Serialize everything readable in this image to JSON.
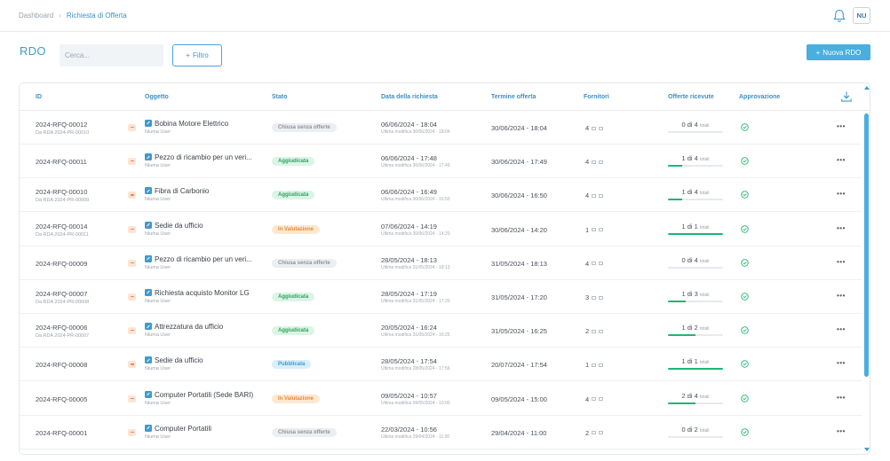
{
  "breadcrumb": {
    "home": "Dashboard",
    "separator": "›",
    "current": "Richiesta di Offerta"
  },
  "user": {
    "initials": "NU"
  },
  "page": {
    "title": "RDO"
  },
  "search": {
    "placeholder": "Cerca..."
  },
  "toolbar": {
    "filter_label": "Filtro",
    "new_label": "Nuova RDO",
    "plus": "+"
  },
  "colors": {
    "accent": "#4aaedf",
    "green": "#22b573",
    "orange": "#e8893a"
  },
  "table": {
    "headers": {
      "id": "ID",
      "oggetto": "Oggetto",
      "stato": "Stato",
      "data": "Data della richiesta",
      "termine": "Termine offerta",
      "fornitori": "Fornitori",
      "offerte": "Offerte ricevute",
      "approvazione": "Approvazione"
    },
    "rows": [
      {
        "id": "2024-RFQ-00012",
        "sub": "Da RDA 2024-PR-00010",
        "title": "Bobina Motore Elettrico",
        "user": "Niuma User",
        "status": "Chiusa senza offerte",
        "status_type": "grey",
        "date": "06/06/2024 - 18:04",
        "modified": "Ultima modifica 30/06/2024 - 18:04",
        "deadline": "30/06/2024 - 18:04",
        "suppliers": "4",
        "offers": "0 di 4",
        "offers_ratio": 0,
        "total": "totali"
      },
      {
        "id": "2024-RFQ-00011",
        "sub": "",
        "title": "Pezzo di ricambio per un veri...",
        "user": "Niuma User",
        "status": "Aggiudicata",
        "status_type": "green",
        "date": "06/06/2024 - 17:48",
        "modified": "Ultima modifica 30/06/2024 - 17:49",
        "deadline": "30/06/2024 - 17:49",
        "suppliers": "4",
        "offers": "1 di 4",
        "offers_ratio": 0.25,
        "total": "totali"
      },
      {
        "id": "2024-RFQ-00010",
        "sub": "Da RDA 2024-PR-00009",
        "title": "Fibra di Carbonio",
        "user": "Niuma User",
        "status": "Aggiudicata",
        "status_type": "green",
        "date": "06/06/2024 - 16:49",
        "modified": "Ultima modifica 30/06/2024 - 16:50",
        "deadline": "30/06/2024 - 16:50",
        "suppliers": "4",
        "offers": "1 di 4",
        "offers_ratio": 0.25,
        "total": "totali"
      },
      {
        "id": "2024-RFQ-00014",
        "sub": "Da RDA 2024-PR-00011",
        "title": "Sedie da ufficio",
        "user": "Niuma User",
        "status": "In Valutazione",
        "status_type": "orange",
        "date": "07/06/2024 - 14:19",
        "modified": "Ultima modifica 30/06/2024 - 14:20",
        "deadline": "30/06/2024 - 14:20",
        "suppliers": "1",
        "offers": "1 di 1",
        "offers_ratio": 1,
        "total": "totali"
      },
      {
        "id": "2024-RFQ-00009",
        "sub": "",
        "title": "Pezzo di ricambio per un veri...",
        "user": "Niuma User",
        "status": "Chiusa senza offerte",
        "status_type": "grey",
        "date": "28/05/2024 - 18:13",
        "modified": "Ultima modifica 31/05/2024 - 18:13",
        "deadline": "31/05/2024 - 18:13",
        "suppliers": "4",
        "offers": "0 di 4",
        "offers_ratio": 0,
        "total": "totali"
      },
      {
        "id": "2024-RFQ-00007",
        "sub": "Da RDA 2024-PR-00008",
        "title": "Richiesta acquisto Monitor LG",
        "user": "Niuma User",
        "status": "Aggiudicata",
        "status_type": "green",
        "date": "28/05/2024 - 17:19",
        "modified": "Ultima modifica 31/05/2024 - 17:20",
        "deadline": "31/05/2024 - 17:20",
        "suppliers": "3",
        "offers": "1 di 3",
        "offers_ratio": 0.3333,
        "total": "totali"
      },
      {
        "id": "2024-RFQ-00006",
        "sub": "Da RDA 2024-PR-00007",
        "title": "Attrezzatura da ufficio",
        "user": "Niuma User",
        "status": "Aggiudicata",
        "status_type": "green",
        "date": "20/05/2024 - 16:24",
        "modified": "Ultima modifica 31/05/2024 - 16:25",
        "deadline": "31/05/2024 - 16:25",
        "suppliers": "2",
        "offers": "1 di 2",
        "offers_ratio": 0.5,
        "total": "totali"
      },
      {
        "id": "2024-RFQ-00008",
        "sub": "",
        "title": "Sedie da ufficio",
        "user": "Niuma User",
        "status": "Pubblicata",
        "status_type": "blue",
        "date": "28/05/2024 - 17:54",
        "modified": "Ultima modifica 28/05/2024 - 17:56",
        "deadline": "20/07/2024 - 17:54",
        "suppliers": "1",
        "offers": "1 di 1",
        "offers_ratio": 1,
        "total": "totali"
      },
      {
        "id": "2024-RFQ-00005",
        "sub": "",
        "title": "Computer Portatili (Sede BARI)",
        "user": "Niuma User",
        "status": "In Valutazione",
        "status_type": "orange",
        "date": "09/05/2024 - 10:57",
        "modified": "Ultima modifica 09/05/2024 - 10:00",
        "deadline": "09/05/2024 - 15:00",
        "suppliers": "4",
        "offers": "2 di 4",
        "offers_ratio": 0.5,
        "total": "totali"
      },
      {
        "id": "2024-RFQ-00001",
        "sub": "",
        "title": "Computer Portatili",
        "user": "Niuma User",
        "status": "Chiusa senza offerte",
        "status_type": "grey",
        "date": "22/03/2024 - 10:56",
        "modified": "Ultima modifica 29/04/2024 - 11:00",
        "deadline": "29/04/2024 - 11:00",
        "suppliers": "2",
        "offers": "0 di 2",
        "offers_ratio": 0,
        "total": "totali"
      }
    ]
  }
}
